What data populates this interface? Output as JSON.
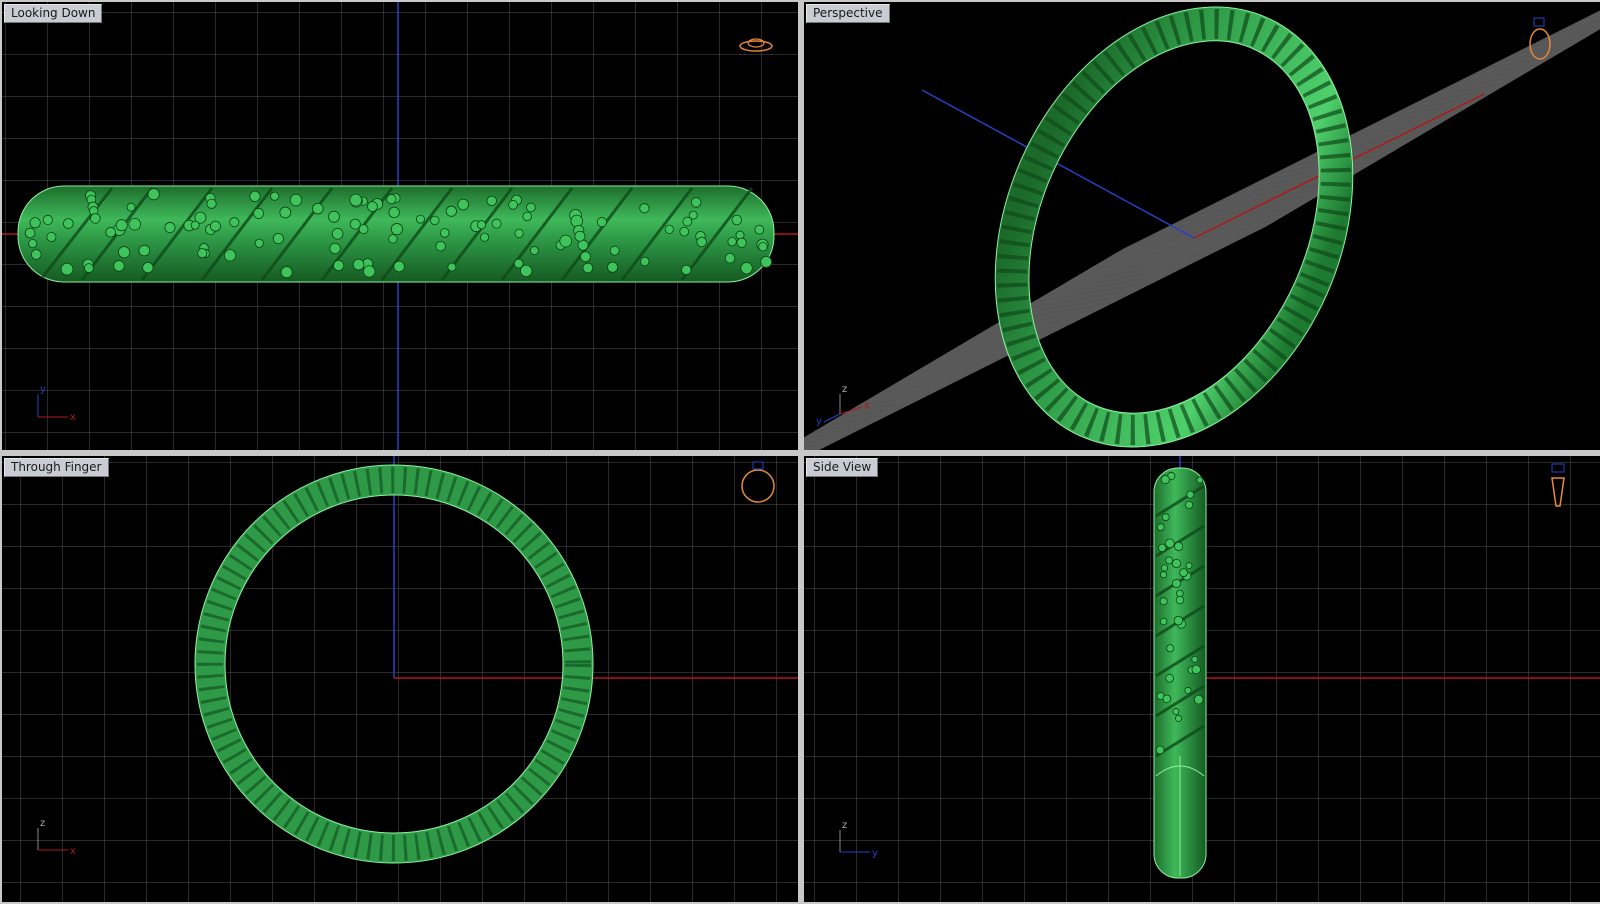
{
  "viewports": {
    "top": {
      "title": "Looking Down",
      "axes": [
        "y",
        "x"
      ]
    },
    "perspective": {
      "title": "Perspective",
      "axes": [
        "z",
        "y",
        "x"
      ]
    },
    "front": {
      "title": "Through Finger",
      "axes": [
        "z",
        "x"
      ]
    },
    "right": {
      "title": "Side View",
      "axes": [
        "z",
        "y"
      ]
    }
  },
  "colors": {
    "background": "#000000",
    "grid": "#5a5a5a",
    "x_axis": "#b01818",
    "y_axis": "#2840c8",
    "object": "#2fa84a",
    "object_highlight": "#7be08a",
    "nav_icon": "#e8883a"
  },
  "icons": {
    "view_cube": "ring-icon"
  }
}
